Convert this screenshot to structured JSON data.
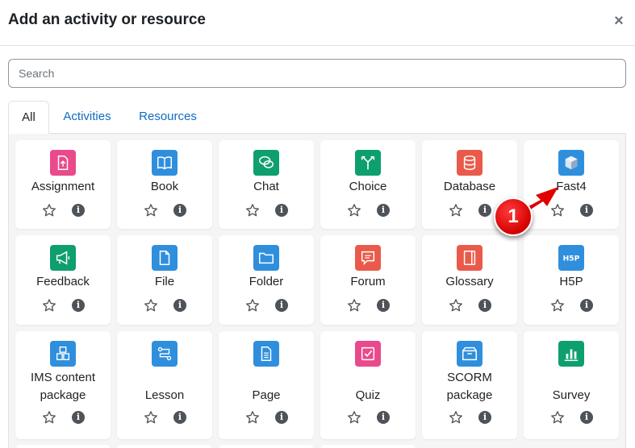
{
  "dialog": {
    "title": "Add an activity or resource",
    "close_symbol": "×"
  },
  "search": {
    "placeholder": "Search",
    "value": ""
  },
  "tabs": [
    {
      "label": "All",
      "active": true
    },
    {
      "label": "Activities",
      "active": false
    },
    {
      "label": "Resources",
      "active": false
    }
  ],
  "activities": [
    {
      "name": "Assignment",
      "icon": "assignment-icon",
      "color": "#e94a8c"
    },
    {
      "name": "Book",
      "icon": "book-icon",
      "color": "#2f8fdd"
    },
    {
      "name": "Chat",
      "icon": "chat-icon",
      "color": "#0e9f6e"
    },
    {
      "name": "Choice",
      "icon": "choice-icon",
      "color": "#0e9f6e"
    },
    {
      "name": "Database",
      "icon": "database-icon",
      "color": "#ea5a4b"
    },
    {
      "name": "Fast4",
      "icon": "cube-icon",
      "color": "#2f8fdd"
    },
    {
      "name": "Feedback",
      "icon": "megaphone-icon",
      "color": "#0e9f6e"
    },
    {
      "name": "File",
      "icon": "file-icon",
      "color": "#2f8fdd"
    },
    {
      "name": "Folder",
      "icon": "folder-icon",
      "color": "#2f8fdd"
    },
    {
      "name": "Forum",
      "icon": "forum-icon",
      "color": "#ea5a4b"
    },
    {
      "name": "Glossary",
      "icon": "glossary-icon",
      "color": "#ea5a4b"
    },
    {
      "name": "H5P",
      "icon": "h5p-icon",
      "color": "#2f8fdd"
    },
    {
      "name": "IMS content package",
      "icon": "ims-package-icon",
      "color": "#2f8fdd"
    },
    {
      "name": "Lesson",
      "icon": "lesson-icon",
      "color": "#2f8fdd"
    },
    {
      "name": "Page",
      "icon": "page-icon",
      "color": "#2f8fdd"
    },
    {
      "name": "Quiz",
      "icon": "quiz-icon",
      "color": "#e94a8c"
    },
    {
      "name": "SCORM package",
      "icon": "scorm-icon",
      "color": "#2f8fdd"
    },
    {
      "name": "Survey",
      "icon": "survey-icon",
      "color": "#0e9f6e"
    }
  ],
  "annotation": {
    "badge_label": "1"
  }
}
